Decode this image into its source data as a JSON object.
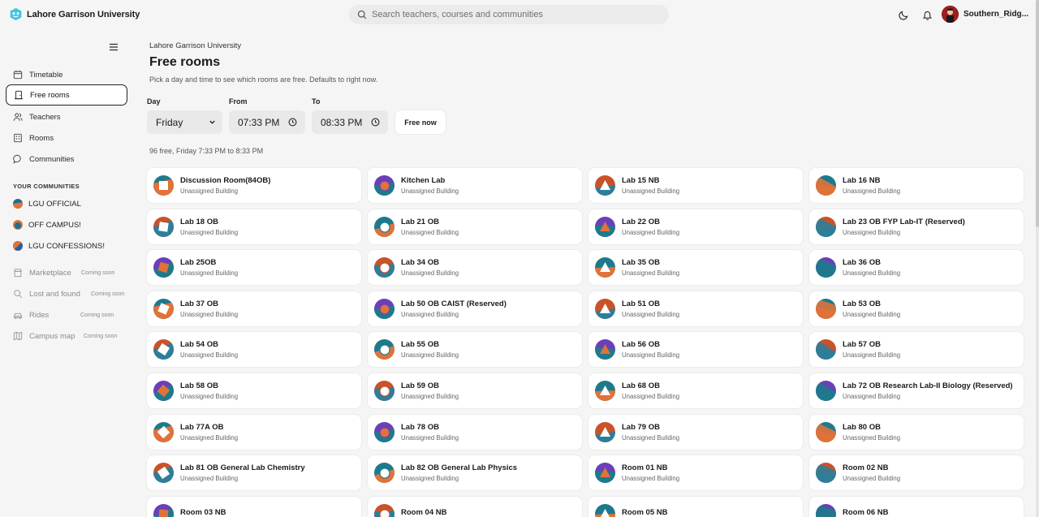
{
  "app": {
    "name": "Lahore Garrison University"
  },
  "search": {
    "placeholder": "Search teachers, courses and communities"
  },
  "user": {
    "name": "Southern_Ridg..."
  },
  "sidebar": {
    "items": [
      {
        "label": "Timetable",
        "icon": "calendar-icon"
      },
      {
        "label": "Free rooms",
        "icon": "door-icon",
        "active": true
      },
      {
        "label": "Teachers",
        "icon": "users-icon"
      },
      {
        "label": "Rooms",
        "icon": "building-icon"
      },
      {
        "label": "Communities",
        "icon": "chat-icon"
      }
    ],
    "communities_title": "YOUR COMMUNITIES",
    "communities": [
      {
        "label": "LGU OFFICIAL"
      },
      {
        "label": "OFF CAMPUS!"
      },
      {
        "label": "LGU CONFESSIONS!"
      }
    ],
    "coming_soon": [
      {
        "label": "Marketplace",
        "badge": "Coming soon"
      },
      {
        "label": "Lost and found",
        "badge": "Coming soon"
      },
      {
        "label": "Rides",
        "badge": "Coming soon"
      },
      {
        "label": "Campus map",
        "badge": "Coming soon"
      }
    ]
  },
  "main": {
    "breadcrumb": "Lahore Garrison University",
    "title": "Free rooms",
    "subtitle": "Pick a day and time to see which rooms are free. Defaults to right now.",
    "day_label": "Day",
    "day_value": "Friday",
    "from_label": "From",
    "from_value": "07:33  PM",
    "to_label": "To",
    "to_value": "08:33  PM",
    "free_now_label": "Free now",
    "summary": "96 free, Friday 7:33 PM to 8:33 PM"
  },
  "rooms": [
    {
      "name": "Discussion Room(84OB)",
      "building": "Unassigned Building"
    },
    {
      "name": "Kitchen Lab",
      "building": "Unassigned Building"
    },
    {
      "name": "Lab 15 NB",
      "building": "Unassigned Building"
    },
    {
      "name": "Lab 16 NB",
      "building": "Unassigned Building"
    },
    {
      "name": "Lab 18 OB",
      "building": "Unassigned Building"
    },
    {
      "name": "Lab 21 OB",
      "building": "Unassigned Building"
    },
    {
      "name": "Lab 22 OB",
      "building": "Unassigned Building"
    },
    {
      "name": "Lab 23 OB FYP Lab-IT (Reserved)",
      "building": "Unassigned Building"
    },
    {
      "name": "Lab 25OB",
      "building": "Unassigned Building"
    },
    {
      "name": "Lab 34 OB",
      "building": "Unassigned Building"
    },
    {
      "name": "Lab 35 OB",
      "building": "Unassigned Building"
    },
    {
      "name": "Lab 36 OB",
      "building": "Unassigned Building"
    },
    {
      "name": "Lab 37 OB",
      "building": "Unassigned Building"
    },
    {
      "name": "Lab 50 OB CAIST (Reserved)",
      "building": "Unassigned Building"
    },
    {
      "name": "Lab 51 OB",
      "building": "Unassigned Building"
    },
    {
      "name": "Lab 53 OB",
      "building": "Unassigned Building"
    },
    {
      "name": "Lab 54 OB",
      "building": "Unassigned Building"
    },
    {
      "name": "Lab 55 OB",
      "building": "Unassigned Building"
    },
    {
      "name": "Lab 56 OB",
      "building": "Unassigned Building"
    },
    {
      "name": "Lab 57 OB",
      "building": "Unassigned Building"
    },
    {
      "name": "Lab 58 OB",
      "building": "Unassigned Building"
    },
    {
      "name": "Lab 59 OB",
      "building": "Unassigned Building"
    },
    {
      "name": "Lab 68 OB",
      "building": "Unassigned Building"
    },
    {
      "name": "Lab 72 OB Research Lab-II Biology (Reserved)",
      "building": "Unassigned Building"
    },
    {
      "name": "Lab 77A OB",
      "building": "Unassigned Building"
    },
    {
      "name": "Lab 78 OB",
      "building": "Unassigned Building"
    },
    {
      "name": "Lab 79 OB",
      "building": "Unassigned Building"
    },
    {
      "name": "Lab 80 OB",
      "building": "Unassigned Building"
    },
    {
      "name": "Lab 81 OB General Lab Chemistry",
      "building": "Unassigned Building"
    },
    {
      "name": "Lab 82 OB General Lab Physics",
      "building": "Unassigned Building"
    },
    {
      "name": "Room 01 NB",
      "building": "Unassigned Building"
    },
    {
      "name": "Room 02 NB",
      "building": "Unassigned Building"
    },
    {
      "name": "Room 03 NB",
      "building": ""
    },
    {
      "name": "Room 04 NB",
      "building": ""
    },
    {
      "name": "Room 05 NB",
      "building": ""
    },
    {
      "name": "Room 06 NB",
      "building": ""
    }
  ],
  "colors": {
    "teal": "#1d7a8c",
    "orange": "#e0723a",
    "purple": "#6b3fb8",
    "active_border": "#222222"
  }
}
